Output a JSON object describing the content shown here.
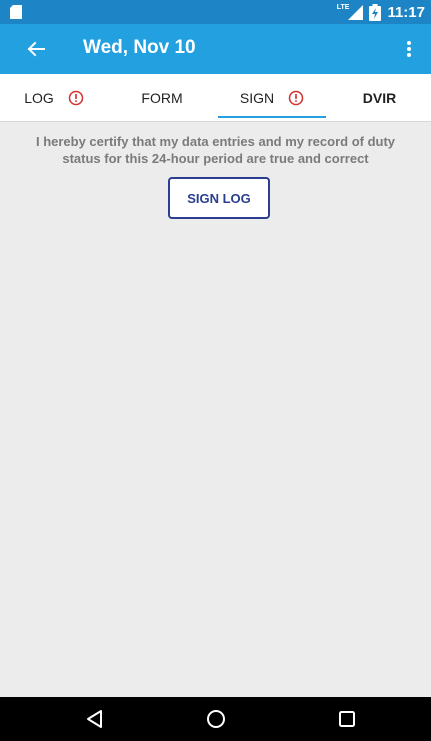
{
  "status_bar": {
    "sd_icon": "sd-card-icon",
    "network": "LTE",
    "signal_icon": "signal-icon",
    "battery_icon": "battery-charging-icon",
    "time": "11:17"
  },
  "app_bar": {
    "back_icon": "arrow-left-icon",
    "title": "Wed, Nov 10",
    "more_icon": "more-vert-icon",
    "color": "#23a0e0"
  },
  "tabs": [
    {
      "label": "LOG",
      "alert": true,
      "active": false
    },
    {
      "label": "FORM",
      "alert": false,
      "active": false
    },
    {
      "label": "SIGN",
      "alert": true,
      "active": true
    },
    {
      "label": "DVIR",
      "alert": false,
      "active": false
    }
  ],
  "sign_page": {
    "certify_text": "I hereby certify that my data entries and my record of duty status for this 24-hour period are true and correct",
    "sign_button_label": "SIGN LOG"
  },
  "colors": {
    "accent": "#23a0e0",
    "status_bar": "#1d85c6",
    "alert": "#d32f2f",
    "button_border": "#2a3d91"
  },
  "nav_bar": {
    "back_icon": "nav-back-icon",
    "home_icon": "nav-home-icon",
    "recents_icon": "nav-recents-icon"
  }
}
